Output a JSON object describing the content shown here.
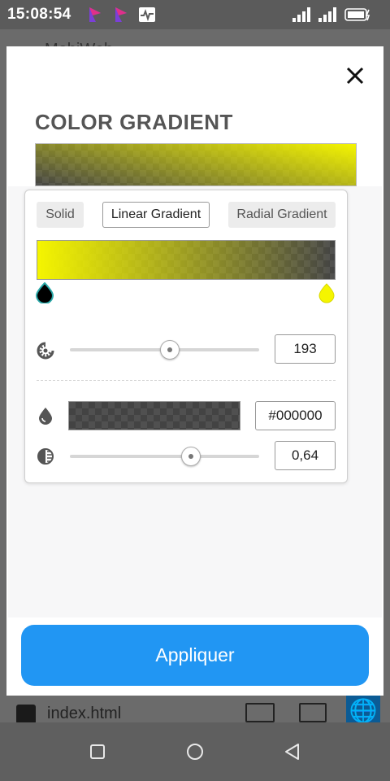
{
  "status_bar": {
    "time": "15:08:54",
    "icons": [
      "app-notification-icon",
      "app-notification-icon",
      "activity-icon",
      "signal-icon",
      "signal-icon",
      "battery-charging-icon"
    ]
  },
  "background_app": {
    "title": "MobiWeb",
    "file_label": "index.html"
  },
  "modal": {
    "title": "COLOR GRADIENT",
    "modes": [
      "Solid",
      "Linear Gradient",
      "Radial Gradient"
    ],
    "active_mode": "Linear Gradient",
    "gradient_stops": [
      {
        "color": "#000000",
        "selected": true
      },
      {
        "color": "#ffff00",
        "selected": false
      }
    ],
    "angle_value": "193",
    "angle_fraction": 0.53,
    "color_value": "#000000",
    "opacity_value": "0,64",
    "opacity_fraction": 0.64,
    "apply_label": "Appliquer"
  },
  "colors": {
    "accent": "#2196f3",
    "gradient_start": "#f5f500",
    "gradient_end": "rgba(0,0,0,0.64)"
  },
  "nav_bar": {
    "icons": [
      "recent-apps-icon",
      "home-icon",
      "back-icon"
    ]
  }
}
